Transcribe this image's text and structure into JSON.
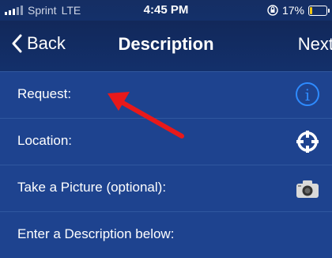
{
  "status_bar": {
    "carrier": "Sprint",
    "network": "LTE",
    "time": "4:45 PM",
    "battery": "17%",
    "battery_level": 0.17,
    "battery_color": "#f2c811"
  },
  "nav": {
    "back_label": "Back",
    "title": "Description",
    "next_label": "Next"
  },
  "rows": [
    {
      "label": "Request:",
      "icon": "info-icon"
    },
    {
      "label": "Location:",
      "icon": "crosshair-icon"
    },
    {
      "label": "Take a Picture (optional):",
      "icon": "camera-icon"
    },
    {
      "label": "Enter a Description below:",
      "icon": ""
    }
  ],
  "annotation": {
    "color": "#e8191a",
    "icon": "red-arrow-annotation"
  },
  "colors": {
    "row_bg": "#1e438f",
    "nav_bg": "#12285a",
    "accent": "#2e8bff"
  }
}
